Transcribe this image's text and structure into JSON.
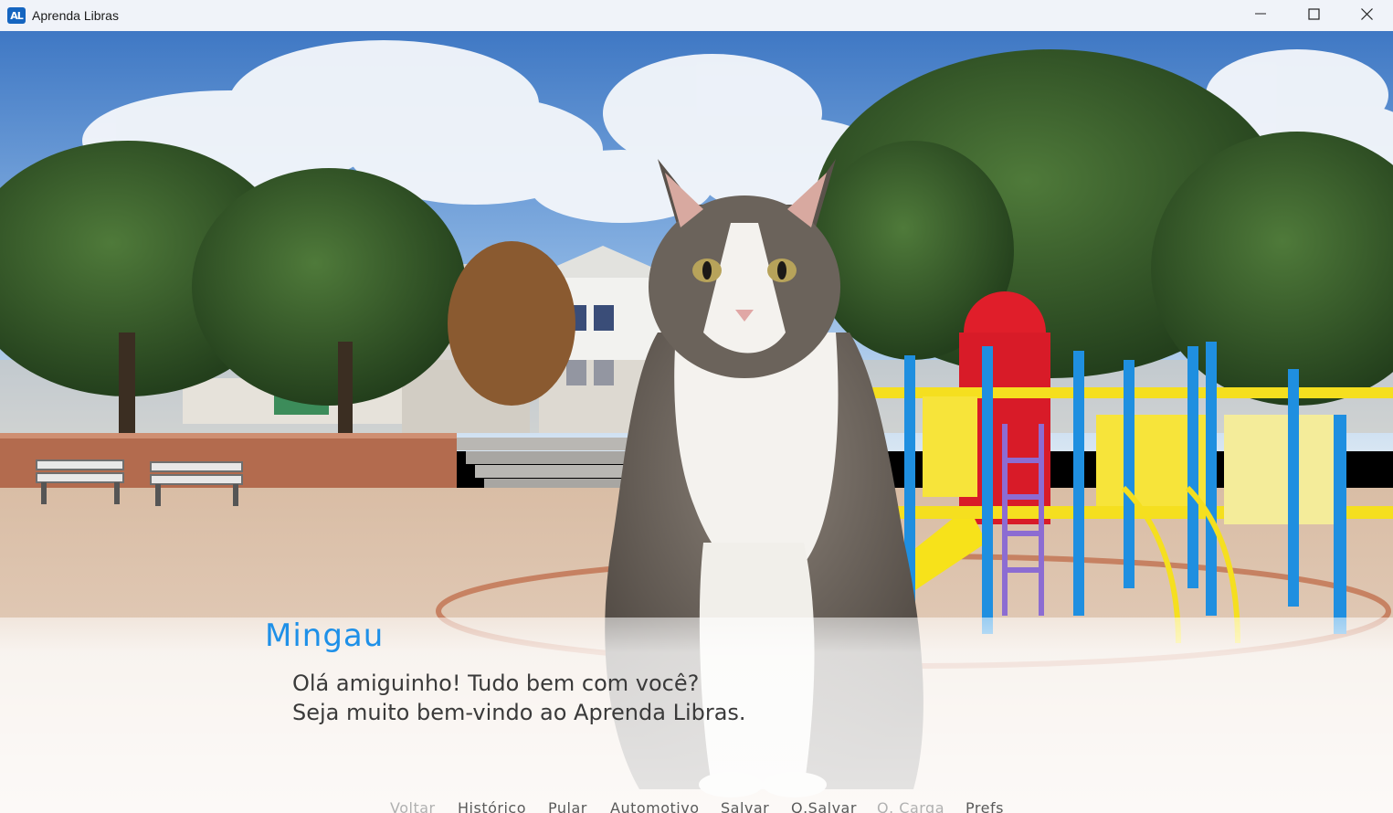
{
  "window": {
    "title": "Aprenda Libras",
    "icon_text": "AL"
  },
  "dialogue": {
    "speaker": "Mingau",
    "lines": [
      "Olá amiguinho! Tudo bem com você?",
      "Seja muito bem-vindo ao Aprenda Libras."
    ]
  },
  "quick_menu": {
    "items": [
      {
        "label": "Voltar",
        "enabled": false
      },
      {
        "label": "Histórico",
        "enabled": true
      },
      {
        "label": "Pular",
        "enabled": true
      },
      {
        "label": "Automotivo",
        "enabled": true
      },
      {
        "label": "Salvar",
        "enabled": true
      },
      {
        "label": "Q.Salvar",
        "enabled": true
      },
      {
        "label": "Q. Carga",
        "enabled": false
      },
      {
        "label": "Prefs",
        "enabled": true
      }
    ]
  },
  "colors": {
    "speaker": "#1e90e8",
    "dialogue_text": "#3a3a3a",
    "menu_enabled": "#5a5a5a",
    "menu_disabled": "#b0b0b0"
  }
}
